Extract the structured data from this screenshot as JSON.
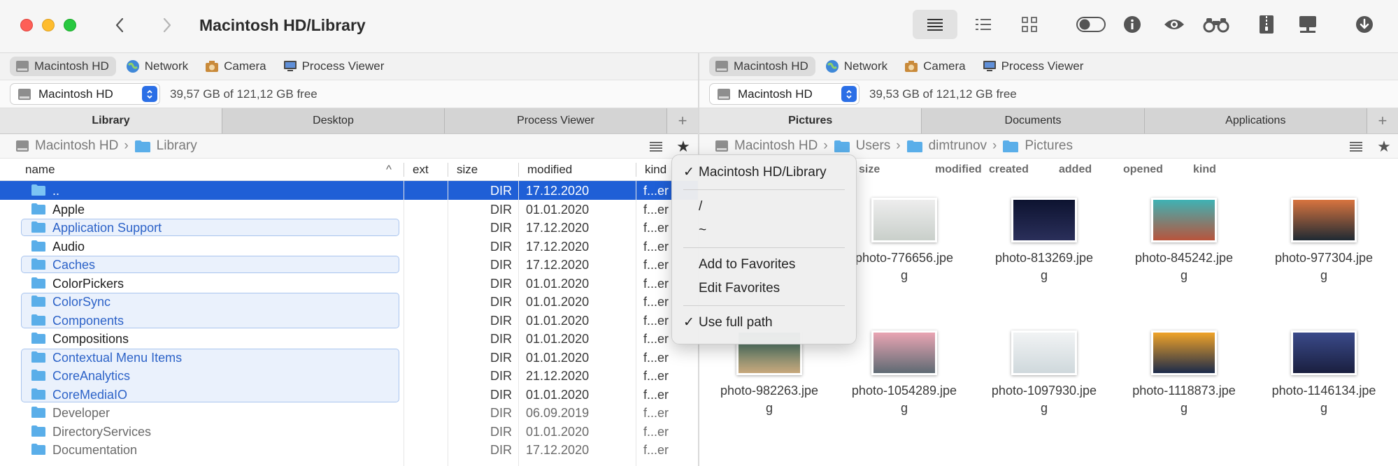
{
  "window": {
    "title": "Macintosh HD/Library"
  },
  "toolbar": {
    "icons": [
      "list-view-icon",
      "detail-view-icon",
      "grid-view-icon",
      "toggle-icon",
      "info-icon",
      "eye-icon",
      "binoculars-icon",
      "archive-icon",
      "network-drive-icon",
      "download-icon"
    ]
  },
  "left": {
    "favorites": [
      "Macintosh HD",
      "Network",
      "Camera",
      "Process Viewer"
    ],
    "drive": "Macintosh HD",
    "free_space": "39,57 GB of 121,12 GB free",
    "tabs": [
      "Library",
      "Desktop",
      "Process Viewer"
    ],
    "path": [
      "Macintosh HD",
      "Library"
    ],
    "columns": [
      "name",
      "ext",
      "size",
      "modified",
      "kind"
    ],
    "rows": [
      {
        "name": "..",
        "size": "DIR",
        "modified": "17.12.2020",
        "kind": "f...er",
        "state": "selected"
      },
      {
        "name": "Apple",
        "size": "DIR",
        "modified": "01.01.2020",
        "kind": "f...er",
        "state": ""
      },
      {
        "name": "Application Support",
        "size": "DIR",
        "modified": "17.12.2020",
        "kind": "f...er",
        "state": "marked"
      },
      {
        "name": "Audio",
        "size": "DIR",
        "modified": "17.12.2020",
        "kind": "f...er",
        "state": ""
      },
      {
        "name": "Caches",
        "size": "DIR",
        "modified": "17.12.2020",
        "kind": "f...er",
        "state": "marked"
      },
      {
        "name": "ColorPickers",
        "size": "DIR",
        "modified": "01.01.2020",
        "kind": "f...er",
        "state": ""
      },
      {
        "name": "ColorSync",
        "size": "DIR",
        "modified": "01.01.2020",
        "kind": "f...er",
        "state": "marked"
      },
      {
        "name": "Components",
        "size": "DIR",
        "modified": "01.01.2020",
        "kind": "f...er",
        "state": "marked"
      },
      {
        "name": "Compositions",
        "size": "DIR",
        "modified": "01.01.2020",
        "kind": "f...er",
        "state": ""
      },
      {
        "name": "Contextual Menu Items",
        "size": "DIR",
        "modified": "01.01.2020",
        "kind": "f...er",
        "state": "marked"
      },
      {
        "name": "CoreAnalytics",
        "size": "DIR",
        "modified": "21.12.2020",
        "kind": "f...er",
        "state": "marked"
      },
      {
        "name": "CoreMediaIO",
        "size": "DIR",
        "modified": "01.01.2020",
        "kind": "f...er",
        "state": "marked"
      },
      {
        "name": "Developer",
        "size": "DIR",
        "modified": "06.09.2019",
        "kind": "f...er",
        "state": "dim"
      },
      {
        "name": "DirectoryServices",
        "size": "DIR",
        "modified": "01.01.2020",
        "kind": "f...er",
        "state": "dim"
      },
      {
        "name": "Documentation",
        "size": "DIR",
        "modified": "17.12.2020",
        "kind": "f...er",
        "state": "dim"
      }
    ]
  },
  "right": {
    "favorites": [
      "Macintosh HD",
      "Network",
      "Camera",
      "Process Viewer"
    ],
    "drive": "Macintosh HD",
    "free_space": "39,53 GB of 121,12 GB free",
    "tabs": [
      "Pictures",
      "Documents",
      "Applications"
    ],
    "path": [
      "Macintosh HD",
      "Users",
      "dimtrunov",
      "Pictures"
    ],
    "columns": [
      "size",
      "modified",
      "created",
      "added",
      "opened",
      "kind"
    ],
    "thumbnails": [
      {
        "name": "photo-776656.jpeg",
        "line1": "photo-776656.jpe",
        "line2": "g",
        "colors": [
          "#ededed",
          "#c9cfca"
        ]
      },
      {
        "name": "photo-813269.jpeg",
        "line1": "photo-813269.jpe",
        "line2": "g",
        "colors": [
          "#0d1330",
          "#2a2f5a"
        ]
      },
      {
        "name": "photo-845242.jpeg",
        "line1": "photo-845242.jpe",
        "line2": "g",
        "colors": [
          "#3fb2b4",
          "#b8543c"
        ]
      },
      {
        "name": "photo-977304.jpeg",
        "line1": "photo-977304.jpe",
        "line2": "g",
        "colors": [
          "#d8743f",
          "#1f2a33"
        ]
      },
      {
        "name": "photo-982263.jpeg",
        "line1": "photo-982263.jpe",
        "line2": "g",
        "colors": [
          "#2f6b63",
          "#c7a77b"
        ]
      },
      {
        "name": "photo-1054289.jpeg",
        "line1": "photo-1054289.jpe",
        "line2": "g",
        "colors": [
          "#e9a5b3",
          "#5e6a73"
        ]
      },
      {
        "name": "photo-1097930.jpeg",
        "line1": "photo-1097930.jpe",
        "line2": "g",
        "colors": [
          "#f1f3f4",
          "#cfd8dc"
        ]
      },
      {
        "name": "photo-1118873.jpeg",
        "line1": "photo-1118873.jpe",
        "line2": "g",
        "colors": [
          "#f0a328",
          "#1b2a4a"
        ]
      },
      {
        "name": "photo-1146134.jpeg",
        "line1": "photo-1146134.jpe",
        "line2": "g",
        "colors": [
          "#3a4a8a",
          "#1a1f3f"
        ]
      }
    ]
  },
  "menu": {
    "items": [
      {
        "label": "Macintosh HD/Library",
        "checked": true
      },
      {
        "separator": true
      },
      {
        "label": "/",
        "checked": false
      },
      {
        "label": "~",
        "checked": false
      },
      {
        "separator": true
      },
      {
        "label": "Add to Favorites",
        "checked": false
      },
      {
        "label": "Edit Favorites",
        "checked": false
      },
      {
        "separator": true
      },
      {
        "label": "Use full path",
        "checked": true
      }
    ]
  },
  "colors": {
    "selection": "#1f5fd6",
    "marked_text": "#2d63c8",
    "folder": "#5aaee9"
  }
}
